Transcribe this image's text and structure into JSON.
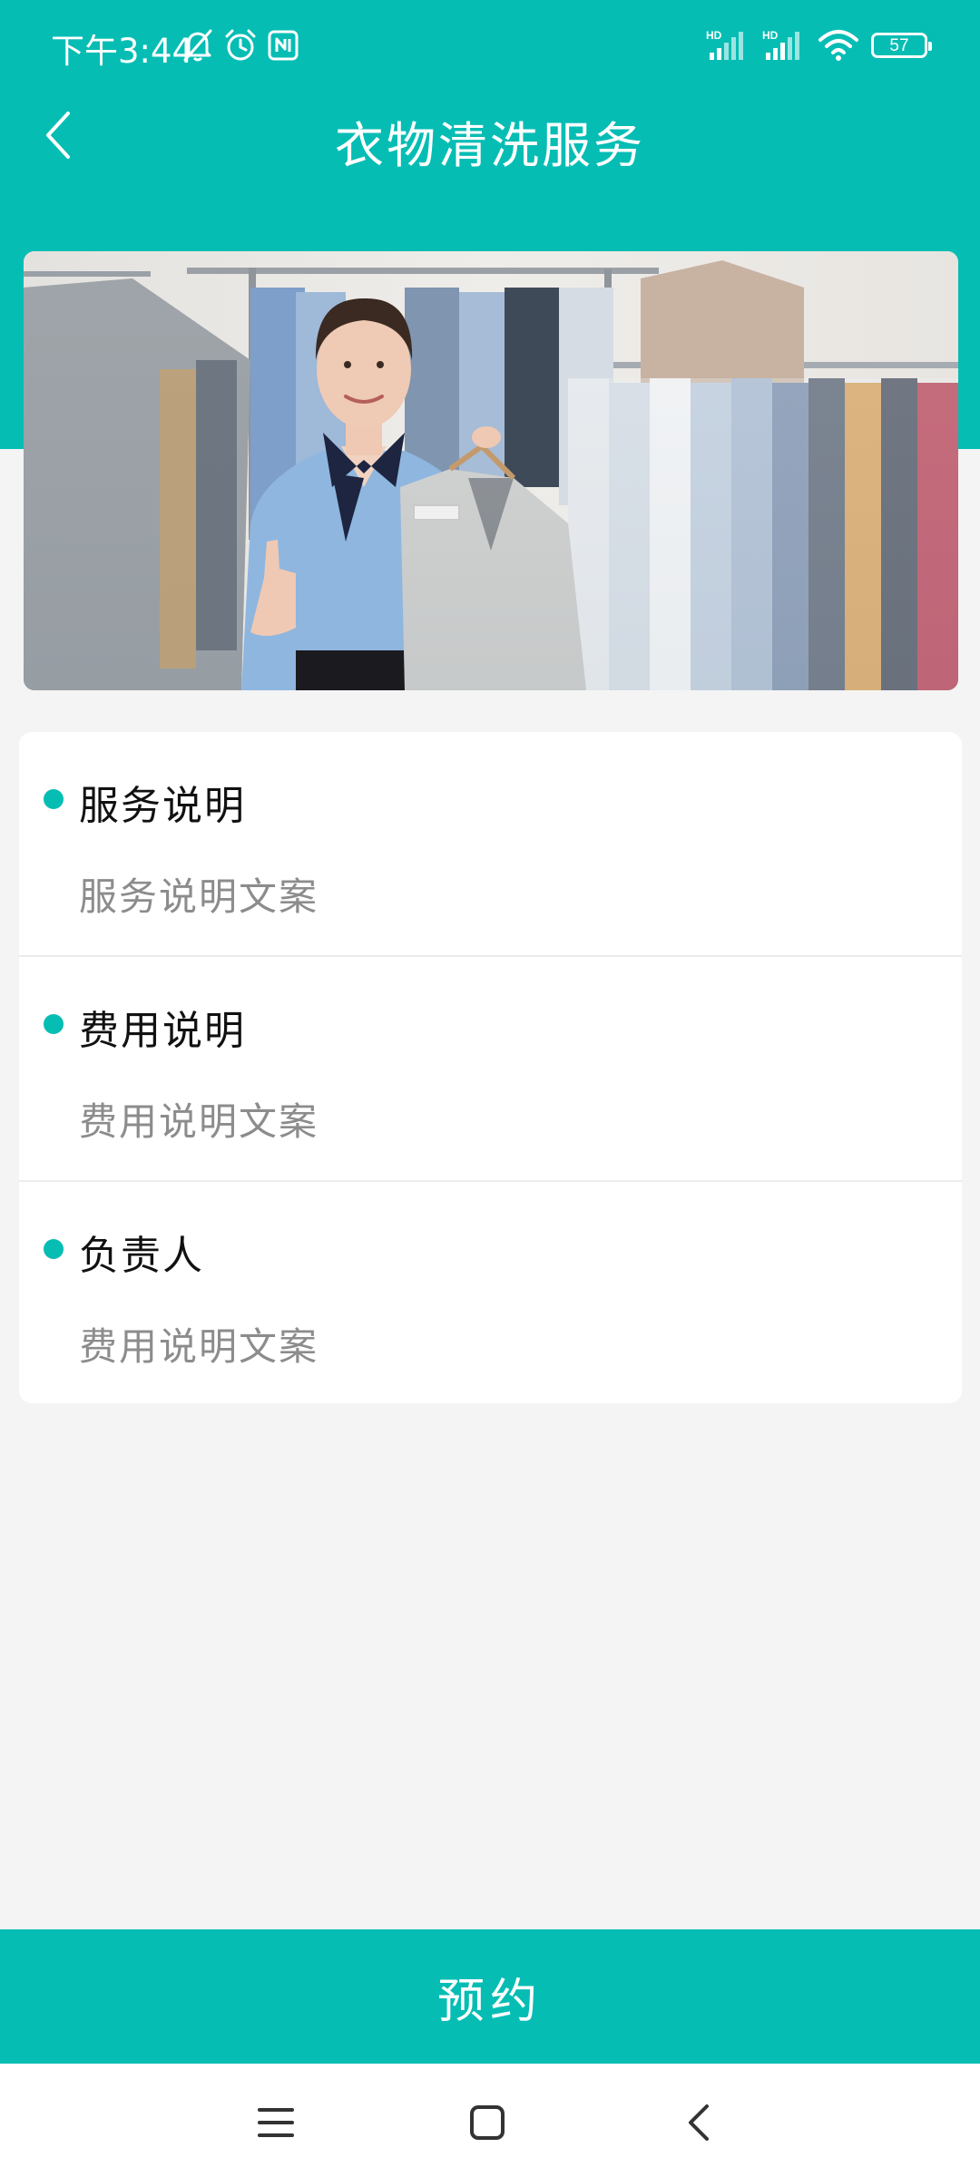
{
  "status_bar": {
    "time": "下午3:44",
    "battery": "57",
    "network_1": "HD",
    "network_2": "HD",
    "icons": [
      "mute-bell-icon",
      "alarm-icon",
      "nfc-icon",
      "signal-icon",
      "signal-icon",
      "wifi-icon",
      "battery-icon"
    ]
  },
  "header": {
    "title": "衣物清洗服务",
    "back_icon": "chevron-left-icon"
  },
  "banner": {
    "icon": "laundry-service-photo"
  },
  "sections": [
    {
      "title": "服务说明",
      "description": "服务说明文案"
    },
    {
      "title": "费用说明",
      "description": "费用说明文案"
    },
    {
      "title": "负责人",
      "description": "费用说明文案"
    }
  ],
  "actions": {
    "book_label": "预约"
  },
  "nav_bar": {
    "icons": [
      "menu-icon",
      "home-icon",
      "back-icon"
    ]
  },
  "colors": {
    "accent": "#06bdb4",
    "background": "#f4f4f4",
    "card": "#ffffff",
    "title_text": "#111111",
    "secondary_text": "#8c8c8c"
  }
}
